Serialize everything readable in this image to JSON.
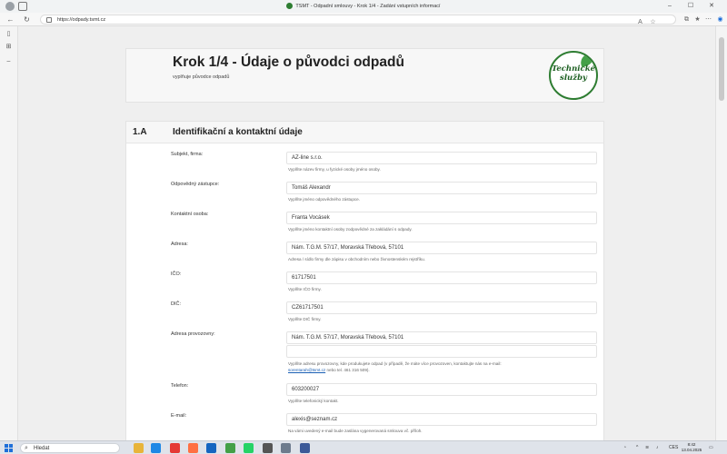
{
  "browser": {
    "tab_title": "TSMT - Odpadní smlouvy - Krok 1/4 - Zadání vstupních informací",
    "url": "https://odpady.tsmt.cz"
  },
  "header": {
    "title": "Krok 1/4 - Údaje o původci odpadů",
    "subtitle": "vyplňuje původce odpadů",
    "logo_text_line1": "Technické",
    "logo_text_line2": "služby"
  },
  "section": {
    "number": "1.A",
    "title": "Identifikační a kontaktní údaje"
  },
  "form": {
    "subjekt": {
      "label": "Subjekt, firma:",
      "value": "AZ-line s.r.o.",
      "help": "Vyplňte název firmy, u fyzické osoby jméno osoby."
    },
    "zastupce": {
      "label": "Odpovědný zástupce:",
      "value": "Tomáš Alexandr",
      "help": "Vyplňte jméno odpovědného zástupce."
    },
    "kontakt": {
      "label": "Kontaktní osoba:",
      "value": "Franta Vocásek",
      "help": "Vyplňte jméno kontaktní osoby zodpovědné za zakládání s odpady."
    },
    "adresa": {
      "label": "Adresa:",
      "value": "Nám. T.G.M. 57/17, Moravská Třebová, 57101",
      "help": "Adresa / sídlo firmy dle zápisu v obchodním nebo živnostenském rejstříku."
    },
    "ico": {
      "label": "IČO:",
      "value": "61717501",
      "help": "Vyplňte IČO firmy."
    },
    "dic": {
      "label": "DIČ:",
      "value": "CZ61717501",
      "help": "Vyplňte DIČ firmy."
    },
    "provozovna": {
      "label": "Adresa provozovny:",
      "value": "Nám. T.G.M. 57/17, Moravská Třebová, 57101",
      "value2": "",
      "help_part1": "Vyplňte adresu provozovny, kde produkujete odpad (v případě, že máte více provozoven, kontaktujte nás na e-mail:",
      "help_link": "sorentarah@tsmt.cz",
      "help_part2": "nebo tel. 461 316 509)."
    },
    "telefon": {
      "label": "Telefon:",
      "value": "603200027",
      "help": "Vyplňte telefonický kontakt."
    },
    "email": {
      "label": "E-mail:",
      "value": "alexis@seznam.cz",
      "help": "Na vámi uvedený e-mail bude zaslána vygenerovaná smlouva vč. příloh."
    }
  },
  "taskbar": {
    "search_placeholder": "Hledat",
    "language": "CES",
    "time": "8:42",
    "date": "13.04.2025"
  }
}
